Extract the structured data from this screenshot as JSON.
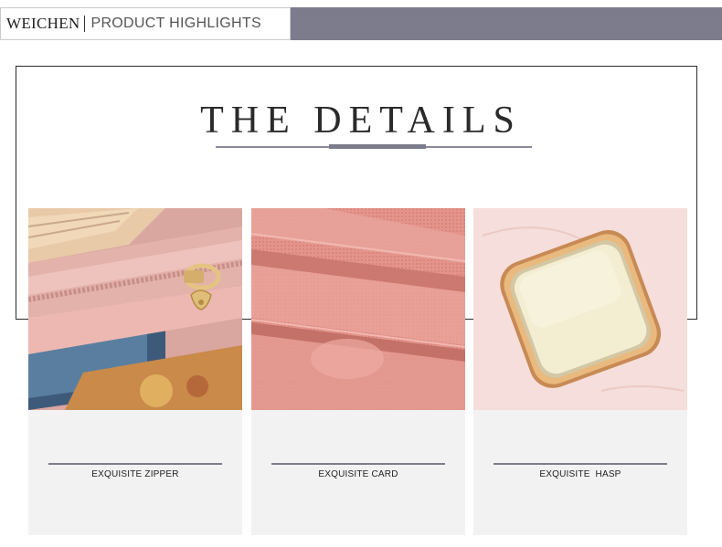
{
  "header": {
    "brand": "WEICHEN",
    "tagline": "PRODUCT HIGHLIGHTS",
    "accent_color": "#7c7c8c"
  },
  "main": {
    "title": "THE DETAILS"
  },
  "cards": [
    {
      "label": "EXQUISITE ZIPPER",
      "image": "pink-wallet-zipper-closeup"
    },
    {
      "label": "EXQUISITE CARD",
      "image": "pink-card-slots-closeup"
    },
    {
      "label": "EXQUISITE  HASP",
      "image": "cream-square-hasp-closeup"
    }
  ]
}
